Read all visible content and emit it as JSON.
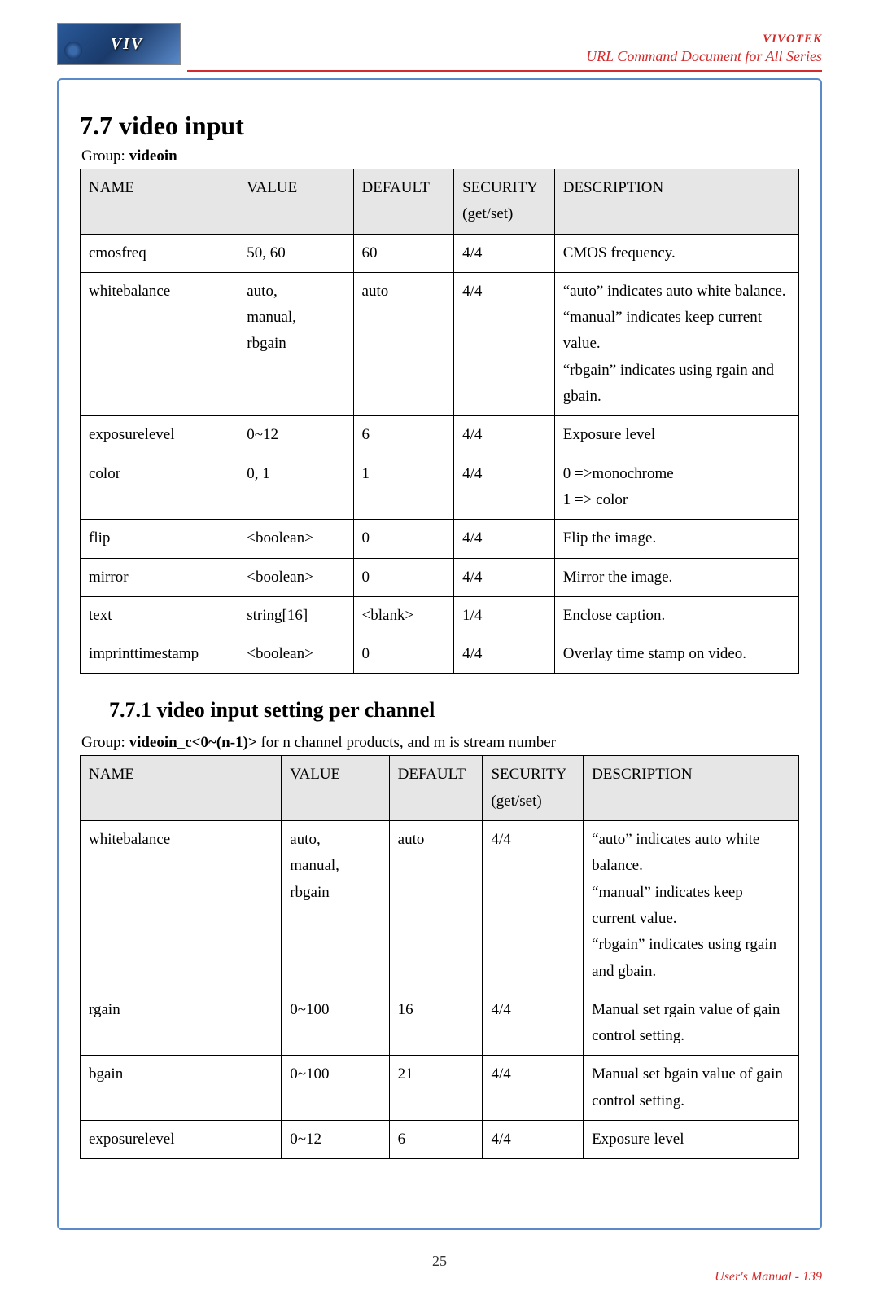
{
  "header": {
    "brand": "VIVOTEK",
    "logo_text": "VIV",
    "doc_title": "URL Command Document for All Series"
  },
  "section": {
    "number_title": "7.7 video input",
    "group_prefix": "Group: ",
    "group_name": "videoin"
  },
  "table1": {
    "headers": {
      "name": "NAME",
      "value": "VALUE",
      "default": "DEFAULT",
      "security": "SECURITY (get/set)",
      "description": "DESCRIPTION"
    },
    "rows": [
      {
        "name": "cmosfreq",
        "value": "50, 60",
        "default": "60",
        "security": "4/4",
        "description": "CMOS frequency."
      },
      {
        "name": "whitebalance",
        "value": "auto,\nmanual,\nrbgain",
        "default": "auto",
        "security": "4/4",
        "description": "“auto” indicates auto white balance.\n“manual” indicates keep current value.\n“rbgain” indicates using rgain and gbain."
      },
      {
        "name": "exposurelevel",
        "value": "0~12",
        "default": "6",
        "security": "4/4",
        "description": "Exposure level"
      },
      {
        "name": "color",
        "value": "0, 1",
        "default": "1",
        "security": "4/4",
        "description": "0 =>monochrome\n1 => color"
      },
      {
        "name": "flip",
        "value": "<boolean>",
        "default": "0",
        "security": "4/4",
        "description": "Flip the image."
      },
      {
        "name": "mirror",
        "value": "<boolean>",
        "default": "0",
        "security": "4/4",
        "description": "Mirror the image."
      },
      {
        "name": "text",
        "value": "string[16]",
        "default": "<blank>",
        "security": "1/4",
        "description": "Enclose caption."
      },
      {
        "name": "imprinttimestamp",
        "value": "<boolean>",
        "default": "0",
        "security": "4/4",
        "description": "Overlay time stamp on video."
      }
    ]
  },
  "subsection": {
    "title": "7.7.1 video input setting per channel",
    "group_prefix": "Group: ",
    "group_name": "videoin_c<0~(n-1)>",
    "group_suffix": " for n channel products, and m is stream number"
  },
  "table2": {
    "headers": {
      "name": "NAME",
      "value": "VALUE",
      "default": "DEFAULT",
      "security": "SECURITY (get/set)",
      "description": "DESCRIPTION"
    },
    "rows": [
      {
        "name": "whitebalance",
        "value": "auto,\nmanual,\nrbgain",
        "default": "auto",
        "security": "4/4",
        "description": "“auto” indicates auto white balance.\n“manual” indicates keep current value.\n“rbgain” indicates using rgain and gbain."
      },
      {
        "name": "rgain",
        "value": "0~100",
        "default": "16",
        "security": "4/4",
        "description": "Manual set rgain value of gain control setting."
      },
      {
        "name": "bgain",
        "value": "0~100",
        "default": "21",
        "security": "4/4",
        "description": "Manual set bgain value of gain control setting."
      },
      {
        "name": "exposurelevel",
        "value": "0~12",
        "default": "6",
        "security": "4/4",
        "description": "Exposure level"
      }
    ]
  },
  "page_number": "25",
  "footer": "User's Manual - 139"
}
